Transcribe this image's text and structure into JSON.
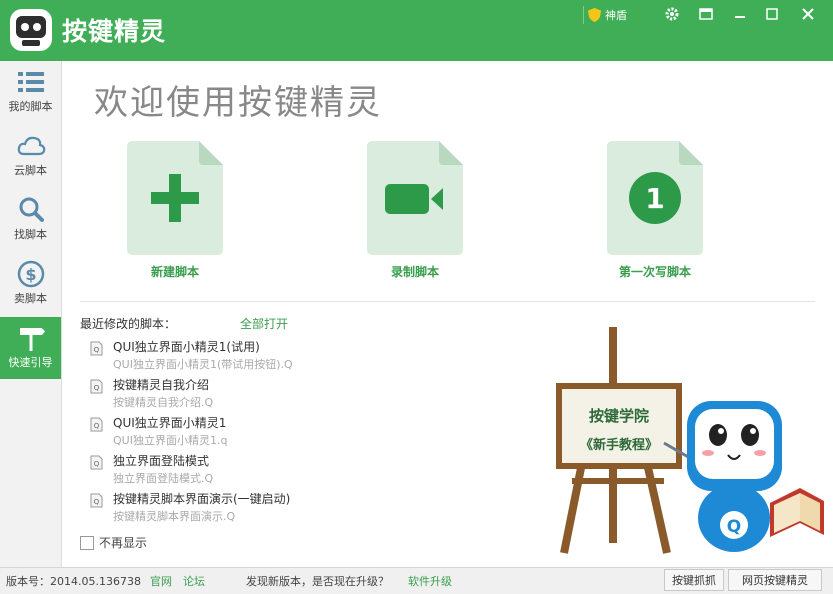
{
  "app": {
    "title": "按键精灵"
  },
  "titlebar": {
    "shield_label": "神盾"
  },
  "sidebar": {
    "items": [
      {
        "label": "我的脚本",
        "icon": "list-icon"
      },
      {
        "label": "云脚本",
        "icon": "cloud-icon"
      },
      {
        "label": "找脚本",
        "icon": "search-icon"
      },
      {
        "label": "卖脚本",
        "icon": "dollar-icon"
      },
      {
        "label": "快速引导",
        "icon": "signpost-icon"
      }
    ]
  },
  "main": {
    "welcome": "欢迎使用按键精灵",
    "cards": [
      {
        "label": "新建脚本",
        "icon": "plus-icon"
      },
      {
        "label": "录制脚本",
        "icon": "video-camera-icon"
      },
      {
        "label": "第一次写脚本",
        "icon": "number-one-icon",
        "glyph": "1"
      }
    ],
    "recent_title": "最近修改的脚本：",
    "open_all": "全部打开",
    "scripts": [
      {
        "name": "QUI独立界面小精灵1(试用)",
        "file": "QUI独立界面小精灵1(带试用按钮).Q"
      },
      {
        "name": "按键精灵自我介绍",
        "file": "按键精灵自我介绍.Q"
      },
      {
        "name": "QUI独立界面小精灵1",
        "file": "QUI独立界面小精灵1.q"
      },
      {
        "name": "独立界面登陆模式",
        "file": "独立界面登陆模式.Q"
      },
      {
        "name": "按键精灵脚本界面演示(一键启动)",
        "file": "按键精灵脚本界面演示.Q"
      }
    ],
    "no_show": "不再显示",
    "board": {
      "line1": "按键学院",
      "line2": "《新手教程》"
    },
    "mascot_letter": "Q"
  },
  "statusbar": {
    "version": "版本号：2014.05.136738",
    "official_site": "官网",
    "forum": "论坛",
    "update_notice": "发现新版本，是否现在升级？",
    "upgrade_link": "软件升级",
    "capture_button": "按键抓抓",
    "web_button": "网页按键精灵"
  },
  "colors": {
    "brand_green": "#3fae56",
    "card_bg": "#d9ecdd",
    "card_fold": "#b9d8c0",
    "link_green": "#3a9e4e"
  }
}
